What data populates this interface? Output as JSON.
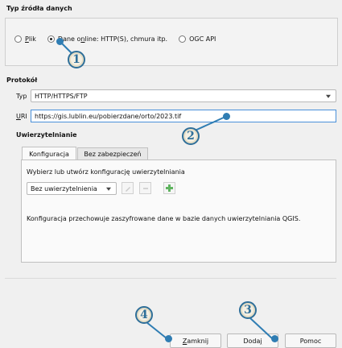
{
  "source_type": {
    "title": "Typ źródła danych",
    "options": [
      {
        "label_pre": "",
        "label_u": "P",
        "label_post": "lik",
        "checked": false
      },
      {
        "label_pre": "Dane o",
        "label_u": "n",
        "label_post": "line: HTTP(S), chmura itp.",
        "checked": true
      },
      {
        "label_pre": "",
        "label_u": "",
        "label_post": "OGC API",
        "checked": false
      }
    ]
  },
  "protocol": {
    "title": "Protokół",
    "type_label": "Typ",
    "type_value": "HTTP/HTTPS/FTP",
    "uri_label_u": "U",
    "uri_label_rest": "RI",
    "uri_value": "https://gis.lublin.eu/pobierzdane/orto/2023.tif"
  },
  "auth": {
    "title": "Uwierzytelnianie",
    "tabs": [
      "Konfiguracja",
      "Bez zabezpieczeń"
    ],
    "prompt": "Wybierz lub utwórz konfigurację uwierzytelniania",
    "config_value": "Bez uwierzytelnienia",
    "note": "Konfiguracja przechowuje zaszyfrowane dane w bazie danych uwierzytelniania QGIS."
  },
  "buttons": {
    "close_u": "Z",
    "close_rest": "amknij",
    "add_pre": "Doda",
    "add_u": "j",
    "help": "Pomoc"
  },
  "callouts": [
    "1",
    "2",
    "3",
    "4"
  ],
  "colors": {
    "accent": "#2f7db3",
    "callout_fill": "#f4f0e4"
  }
}
